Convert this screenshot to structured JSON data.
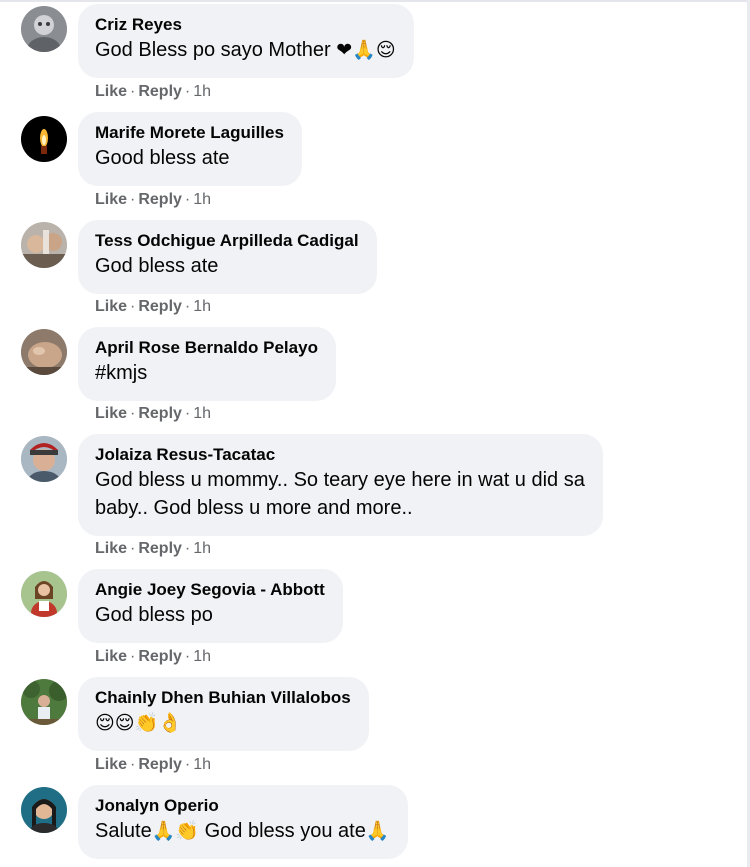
{
  "actions": {
    "like": "Like",
    "reply": "Reply",
    "separator": "·"
  },
  "comments": [
    {
      "author": "Criz Reyes",
      "text": "God Bless po sayo Mother",
      "emoji": "❤🙏😌",
      "time": "1h"
    },
    {
      "author": "Marife Morete Laguilles",
      "text": "Good bless ate",
      "emoji": "",
      "time": "1h"
    },
    {
      "author": "Tess Odchigue Arpilleda Cadigal",
      "text": "God bless ate",
      "emoji": "",
      "time": "1h"
    },
    {
      "author": "April Rose Bernaldo Pelayo",
      "text": "#kmjs",
      "emoji": "",
      "time": "1h"
    },
    {
      "author": "Jolaiza Resus-Tacatac",
      "text": "God bless u mommy.. So teary eye here in wat u did sa",
      "text2": "baby.. God bless u more and more..",
      "emoji": "",
      "time": "1h"
    },
    {
      "author": "Angie Joey Segovia - Abbott",
      "text": "God bless po",
      "emoji": "",
      "time": "1h"
    },
    {
      "author": "Chainly Dhen Buhian Villalobos",
      "text": "",
      "emoji": "😌😌👏👌",
      "time": "1h"
    },
    {
      "author": "Jonalyn Operio",
      "text": "Salute",
      "emoji": "🙏👏",
      "text_after": " God bless you ate",
      "emoji_after": "🙏",
      "time": ""
    }
  ]
}
